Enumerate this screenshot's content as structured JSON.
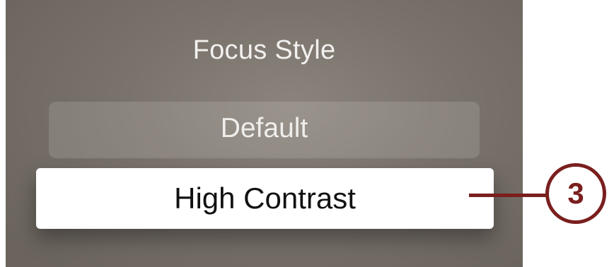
{
  "panel": {
    "title": "Focus Style",
    "options": [
      {
        "label": "Default",
        "state": "unfocused"
      },
      {
        "label": "High Contrast",
        "state": "focused"
      }
    ]
  },
  "callout": {
    "number": "3",
    "color": "#7a1f1e"
  }
}
